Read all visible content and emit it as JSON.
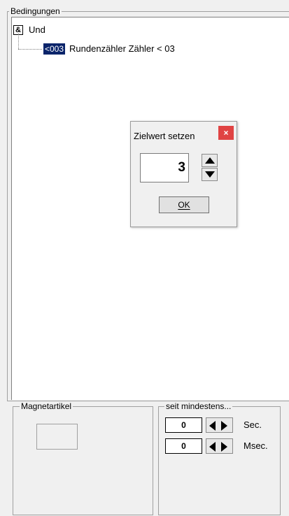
{
  "conditions": {
    "group_title": "Bedingungen",
    "root": {
      "icon_text": "&",
      "label": "Und"
    },
    "child": {
      "code": "<003",
      "label": "Rundenzähler Zähler < 03"
    }
  },
  "dialog": {
    "title": "Zielwert setzen",
    "close_glyph": "×",
    "value": "3",
    "ok_label": "OK"
  },
  "magnet": {
    "group_title": "Magnetartikel"
  },
  "since": {
    "group_title": "seit mindestens...",
    "seconds_value": "0",
    "seconds_unit": "Sec.",
    "msec_value": "0",
    "msec_unit": "Msec."
  },
  "colors": {
    "selection": "#0a246a",
    "close": "#e04343",
    "window": "#f0f0f0"
  },
  "icons": [
    "and-icon",
    "close-icon",
    "spin-up-icon",
    "spin-down-icon",
    "arrow-left-icon",
    "arrow-right-icon"
  ]
}
